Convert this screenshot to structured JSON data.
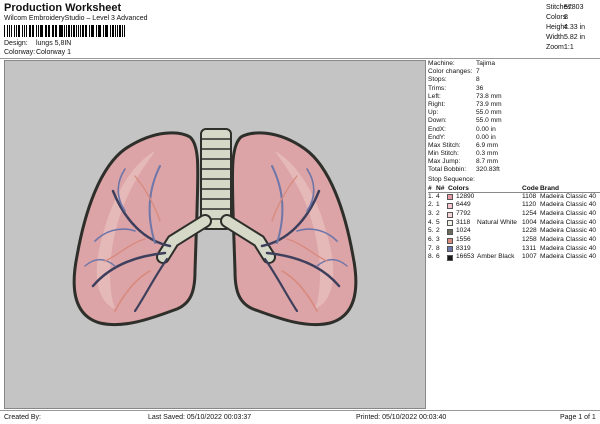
{
  "header": {
    "title": "Production Worksheet",
    "subtitle": "Wilcom EmbroideryStudio – Level 3 Advanced",
    "design_label": "Design:",
    "design_value": "lungs 5,8IN",
    "colorway_label": "Colorway:",
    "colorway_value": "Colorway 1"
  },
  "stats": [
    {
      "label": "Stitches:",
      "value": "57803"
    },
    {
      "label": "Colors:",
      "value": "8"
    },
    {
      "label": "Height:",
      "value": "4.33 in"
    },
    {
      "label": "Width:",
      "value": "5.82 in"
    },
    {
      "label": "Zoom:",
      "value": "1:1"
    }
  ],
  "machine_info": [
    {
      "label": "Machine:",
      "value": "Tajima"
    },
    {
      "label": "Color changes:",
      "value": "7"
    },
    {
      "label": "Stops:",
      "value": "8"
    },
    {
      "label": "Trims:",
      "value": "36"
    },
    {
      "label": "Left:",
      "value": "73.8 mm"
    },
    {
      "label": "Right:",
      "value": "73.9 mm"
    },
    {
      "label": "Up:",
      "value": "55.0 mm"
    },
    {
      "label": "Down:",
      "value": "55.0 mm"
    },
    {
      "label": "EndX:",
      "value": "0.00 in"
    },
    {
      "label": "EndY:",
      "value": "0.00 in"
    },
    {
      "label": "Max Stitch:",
      "value": "6.9 mm"
    },
    {
      "label": "Min Stitch:",
      "value": "0.3 mm"
    },
    {
      "label": "Max Jump:",
      "value": "8.7 mm"
    },
    {
      "label": "Total Bobbin:",
      "value": "320.83ft"
    }
  ],
  "sequence": {
    "title": "Stop Sequence:",
    "headers": {
      "idx": "#",
      "n": "N#",
      "stitches": "Colors",
      "code": "Code",
      "brand": "Brand"
    },
    "rows": [
      {
        "idx": "1.",
        "n": "4",
        "color": "#e79aa4",
        "stitches": "12890",
        "name": "",
        "code": "1108",
        "brand": "Madeira Classic 40"
      },
      {
        "idx": "2.",
        "n": "1",
        "color": "#f4c6cd",
        "stitches": "6449",
        "name": "",
        "code": "1120",
        "brand": "Madeira Classic 40"
      },
      {
        "idx": "3.",
        "n": "2",
        "color": "#f7d6d9",
        "stitches": "7792",
        "name": "",
        "code": "1254",
        "brand": "Madeira Classic 40"
      },
      {
        "idx": "4.",
        "n": "5",
        "color": "#f0efe6",
        "stitches": "3118",
        "name": "Natural White",
        "code": "1004",
        "brand": "Madeira Classic 40"
      },
      {
        "idx": "5.",
        "n": "2",
        "color": "#6b6b5e",
        "stitches": "1024",
        "name": "",
        "code": "1228",
        "brand": "Madeira Classic 40"
      },
      {
        "idx": "6.",
        "n": "3",
        "color": "#d98a7e",
        "stitches": "1556",
        "name": "",
        "code": "1258",
        "brand": "Madeira Classic 40"
      },
      {
        "idx": "7.",
        "n": "8",
        "color": "#6f76a8",
        "stitches": "8319",
        "name": "",
        "code": "1311",
        "brand": "Madeira Classic 40"
      },
      {
        "idx": "8.",
        "n": "6",
        "color": "#1a1a1a",
        "stitches": "16653",
        "name": "Amber Black",
        "code": "1007",
        "brand": "Madeira Classic 40"
      }
    ]
  },
  "footer": {
    "created": "Created By:",
    "saved": "Last Saved: 05/10/2022 00:03:37",
    "printed": "Printed: 05/10/2022 00:03:40",
    "page": "Page 1 of 1"
  },
  "colors": {
    "canvas_bg": "#c4c4c4",
    "lung_fill": "#dca4a6",
    "lung_light": "#eac2c2",
    "lung_outline": "#2e2e2a",
    "trachea_fill": "#d6d8c8",
    "vessel_blue": "#6f76a8",
    "vessel_orange": "#d98a7e",
    "vessel_dark": "#3d3f5c"
  }
}
